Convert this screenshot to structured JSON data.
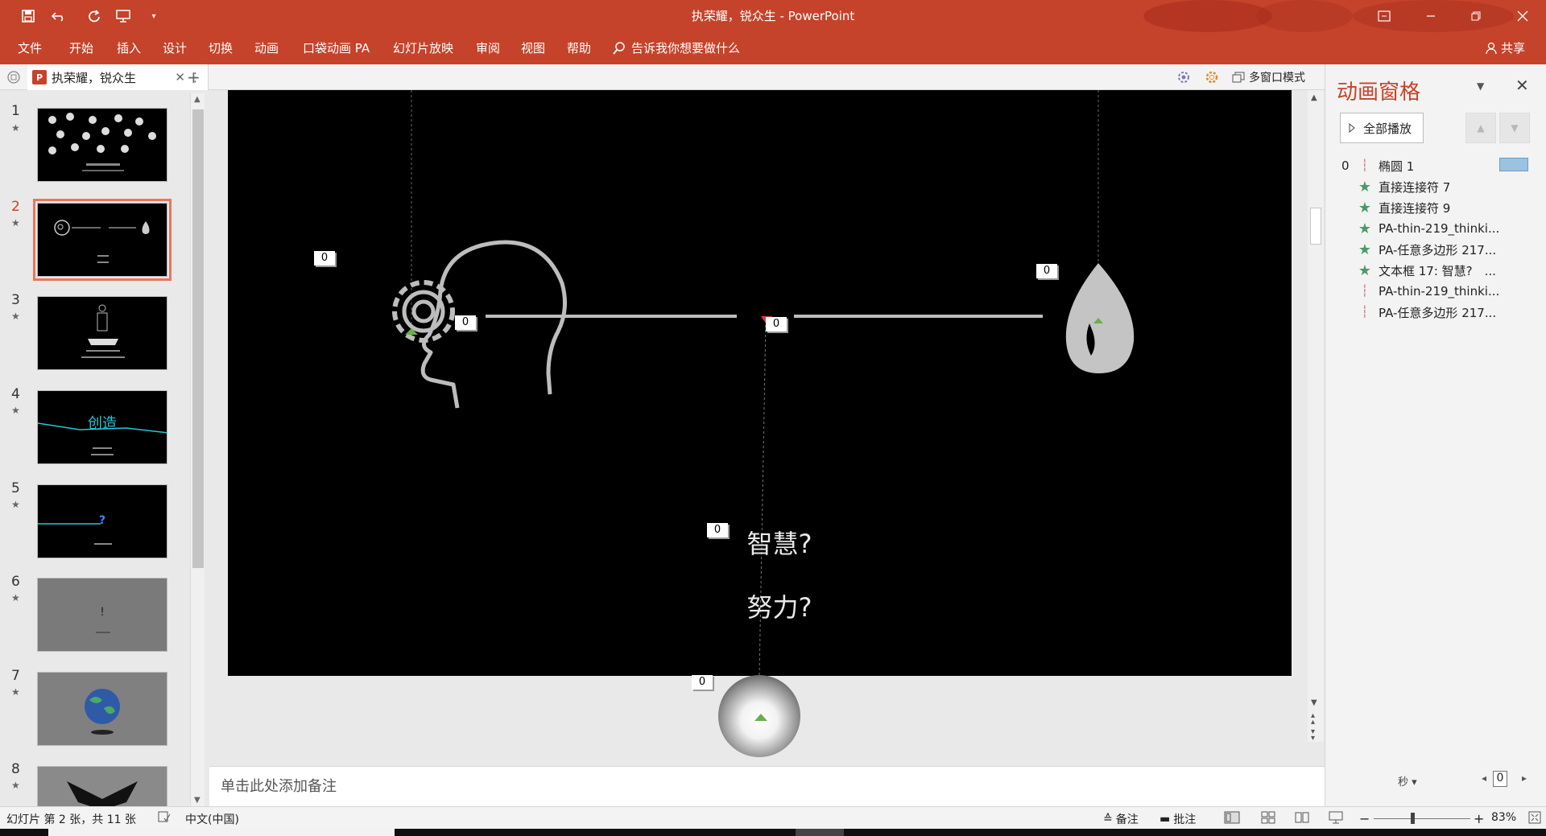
{
  "window": {
    "title": "执荣耀，锐众生 - PowerPoint",
    "controls": [
      "restore-window",
      "minimize",
      "maximize",
      "close"
    ]
  },
  "quick_access": [
    "save-icon",
    "undo-icon",
    "redo-icon",
    "present-icon",
    "customize-icon"
  ],
  "ribbon": {
    "tabs": [
      "文件",
      "开始",
      "插入",
      "设计",
      "切换",
      "动画",
      "口袋动画 PA",
      "幻灯片放映",
      "审阅",
      "视图",
      "帮助"
    ],
    "search_placeholder": "告诉我你想要做什么",
    "share_label": "共享"
  },
  "doc_tab": {
    "label": "执荣耀，锐众生",
    "multi_window_label": "多窗口模式"
  },
  "thumbnails": [
    {
      "num": "1",
      "caption": "",
      "bg": "#000000"
    },
    {
      "num": "2",
      "caption": "智慧? 努力?",
      "bg": "#000000"
    },
    {
      "num": "3",
      "caption": "",
      "bg": "#000000"
    },
    {
      "num": "4",
      "caption": "创造",
      "bg": "#000000"
    },
    {
      "num": "5",
      "caption": "?",
      "bg": "#000000"
    },
    {
      "num": "6",
      "caption": "!",
      "bg": "#7a7a7a"
    },
    {
      "num": "7",
      "caption": "",
      "bg": "#808080"
    },
    {
      "num": "8",
      "caption": "",
      "bg": "#8a8a8a"
    }
  ],
  "slide": {
    "text_line1": "智慧?",
    "text_line2": "努力?",
    "tags": [
      "0",
      "0",
      "0",
      "0",
      "0",
      "0"
    ]
  },
  "notes_placeholder": "单击此处添加备注",
  "animation_pane": {
    "title": "动画窗格",
    "play_all": "全部播放",
    "items": [
      {
        "num": "0",
        "label": "椭圆 1",
        "icon": "motion-path-icon"
      },
      {
        "num": "",
        "label": "直接连接符 7",
        "icon": "star-icon"
      },
      {
        "num": "",
        "label": "直接连接符 9",
        "icon": "star-icon"
      },
      {
        "num": "",
        "label": "PA-thin-219_thinki...",
        "icon": "star-icon"
      },
      {
        "num": "",
        "label": "PA-任意多边形 217...",
        "icon": "star-icon"
      },
      {
        "num": "",
        "label": "文本框 17: 智慧?　...",
        "icon": "star-icon"
      },
      {
        "num": "",
        "label": "PA-thin-219_thinki...",
        "icon": "motion-path-icon"
      },
      {
        "num": "",
        "label": "PA-任意多边形 217...",
        "icon": "motion-path-icon"
      }
    ],
    "seconds_label": "秒",
    "timeline_value": "0"
  },
  "status": {
    "slide_info": "幻灯片 第 2 张，共 11 张",
    "language": "中文(中国)",
    "notes_label": "备注",
    "comments_label": "批注",
    "zoom": "83%"
  },
  "colors": {
    "accent": "#c5432a",
    "selection": "#e8775d",
    "star": "#4a9a6a"
  }
}
